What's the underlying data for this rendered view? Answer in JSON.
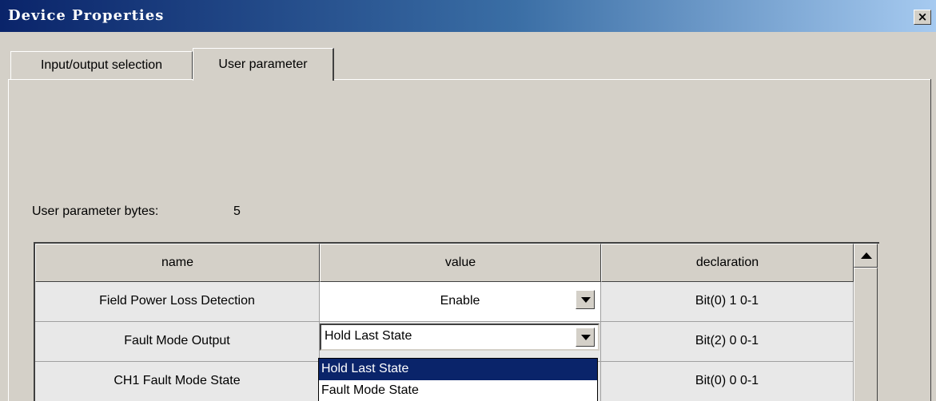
{
  "window": {
    "title": "Device Properties",
    "close_label": "×"
  },
  "tabs": [
    {
      "label": "Input/output selection",
      "active": false
    },
    {
      "label": "User parameter",
      "active": true
    }
  ],
  "user_parameter_bytes": {
    "label": "User parameter bytes:",
    "value": "5"
  },
  "table": {
    "columns": [
      "name",
      "value",
      "declaration"
    ],
    "rows": [
      {
        "name": "Field Power Loss Detection",
        "value": "Enable",
        "declaration": "Bit(0) 1 0-1"
      },
      {
        "name": "Fault Mode Output",
        "value": "Hold Last State",
        "declaration": "Bit(2) 0 0-1"
      },
      {
        "name": "CH1 Fault Mode State",
        "value": "",
        "declaration": "Bit(0) 0 0-1"
      }
    ]
  },
  "dropdown": {
    "options": [
      "Hold Last State",
      "Fault Mode State"
    ],
    "selected": "Hold Last State"
  },
  "colors": {
    "title_bar_start": "#0a246a",
    "title_bar_end": "#a6caf0",
    "selection": "#0a246a",
    "dialog_face": "#d4d0c8"
  },
  "icons": [
    "close-icon",
    "chevron-down-icon",
    "arrow-up-icon"
  ]
}
